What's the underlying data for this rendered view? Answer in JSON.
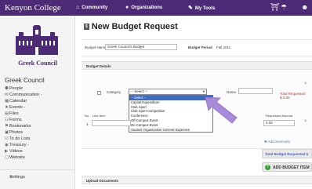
{
  "topbar": {
    "brand": "Kenyon College",
    "nav": [
      "Community",
      "Organizations",
      "My Tools"
    ]
  },
  "sidebar": {
    "logo_text": "Greek Council",
    "group_title": "Greek Council",
    "items": [
      {
        "icon": "people-icon",
        "glyph": "⚉",
        "label": "People"
      },
      {
        "icon": "communication-icon",
        "glyph": "✉",
        "label": "Communication -"
      },
      {
        "icon": "calendar-icon",
        "glyph": "▦",
        "label": "Calendar"
      },
      {
        "icon": "events-icon",
        "glyph": "★",
        "label": "Events -"
      },
      {
        "icon": "files-icon",
        "glyph": "▤",
        "label": "Files"
      },
      {
        "icon": "forms-icon",
        "glyph": "☷",
        "label": "Forms"
      },
      {
        "icon": "bookmarks-icon",
        "glyph": "⚑",
        "label": "Bookmarks"
      },
      {
        "icon": "photos-icon",
        "glyph": "▣",
        "label": "Photos"
      },
      {
        "icon": "todo-icon",
        "glyph": "☑",
        "label": "To do Lists"
      },
      {
        "icon": "treasury-icon",
        "glyph": "◉",
        "label": "Treasury -"
      },
      {
        "icon": "videos-icon",
        "glyph": "▶",
        "label": "Videos"
      },
      {
        "icon": "website-icon",
        "glyph": "▢",
        "label": "Website"
      }
    ],
    "settings_label": "Settings"
  },
  "page": {
    "title": "New Budget Request",
    "badge": "$"
  },
  "budget": {
    "name_label": "Budget Name",
    "name_value": "Greek Council's Budget",
    "period_label": "Budget Period",
    "period_value": "Fall 2011"
  },
  "details": {
    "section_label": "Budget Details",
    "category_label": "Category",
    "category_value": "-- Select --",
    "name_label": "Name",
    "total_requested_label": "Total Requested",
    "total_requested_value": "$ 0.00",
    "options": [
      "-- Select --",
      "Capital Expenditure",
      "Club Sport",
      "Club Sport Competition",
      "Conference",
      "Off-Campus Event",
      "On-Campus Event",
      "Student Organization General Expenses"
    ],
    "line_no_label": "No.",
    "line_item_label": "Line Item",
    "requested_amount_label": "Requested Amount",
    "line_no_value": "1",
    "amount_value": "0.00"
  },
  "actions": {
    "add_line": "Add Summary",
    "total_label": "Total Budget Requested $",
    "add_budget_item": "ADD BUDGET ITEM"
  },
  "upload": {
    "section_label": "Upload Documents"
  },
  "colors": {
    "nav_bg": "#4d2a76",
    "arrow": "#a78bd8",
    "select_highlight": "#3b6cc5"
  }
}
